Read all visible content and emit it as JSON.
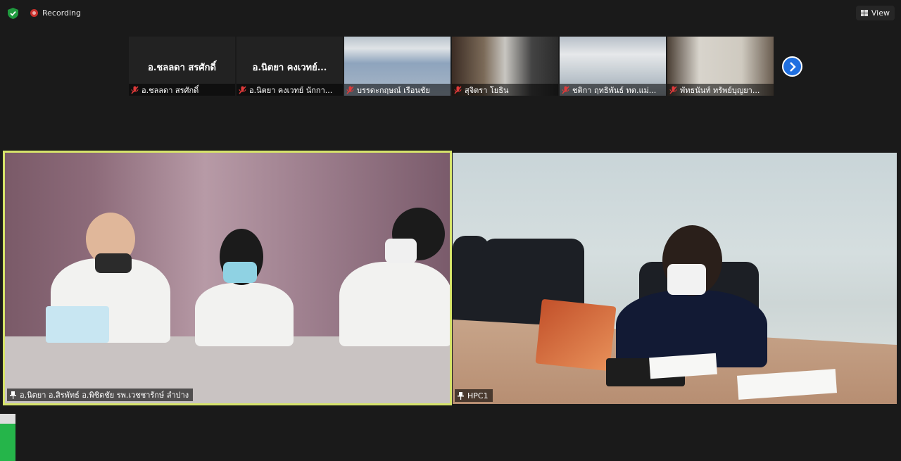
{
  "topbar": {
    "recording_label": "Recording",
    "view_label": "View"
  },
  "gallery": {
    "thumbnails": [
      {
        "display_name": "อ.ชลลดา สรศักดิ์",
        "label": "อ.ชลลดา สรศักดิ์",
        "muted": true
      },
      {
        "display_name": "อ.นิตยา คงเวทย์...",
        "label": "อ.นิตยา คงเวทย์ นักกา...",
        "muted": true
      },
      {
        "label": "บรรดะกฤษณ์ เรือนชัย",
        "muted": true
      },
      {
        "label": "สุจิตรา โยธิน",
        "muted": true
      },
      {
        "label": "ชติกา ฤทธิพันธ์ ทต.แม่...",
        "muted": true
      },
      {
        "label": "พัทธนันท์ ทรัพย์บุญยา...",
        "muted": true
      }
    ]
  },
  "main": {
    "left_tile_name": "อ.นิตยา อ.สิรพัทธ์ อ.พิชิตชัย รพ.เวชชารักษ์ ลำปาง",
    "right_tile_name": "HPC1"
  },
  "colors": {
    "active_speaker_border": "#d6e36a",
    "next_button": "#1f6fe0",
    "recording_dot": "#c9302c"
  }
}
